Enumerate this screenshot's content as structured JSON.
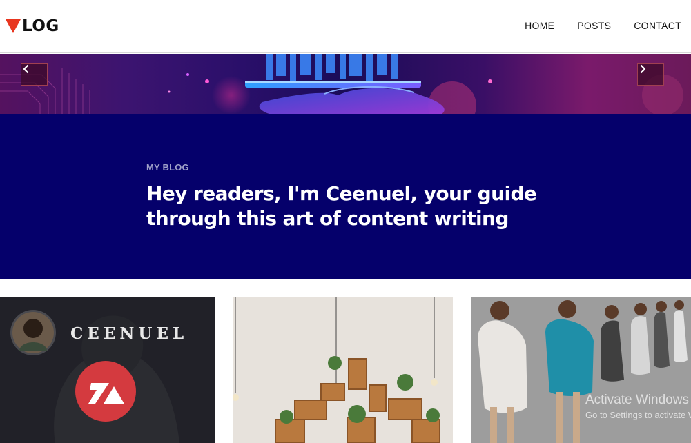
{
  "brand": {
    "logo_text": "LOG",
    "accent": "#e8361f"
  },
  "nav": {
    "items": [
      "HOME",
      "POSTS",
      "CONTACT"
    ]
  },
  "hero": {
    "prev_icon": "chevron-left-icon",
    "next_icon": "chevron-right-icon",
    "kicker": "MY BLOG",
    "headline": "Hey readers, I'm Ceenuel, your guide through this art of content writing",
    "band_color": "#05006b"
  },
  "cards": [
    {
      "logo_text": "CEENUEL"
    },
    {},
    {}
  ],
  "watermark": {
    "title": "Activate Windows",
    "subtitle": "Go to Settings to activate Windows."
  }
}
